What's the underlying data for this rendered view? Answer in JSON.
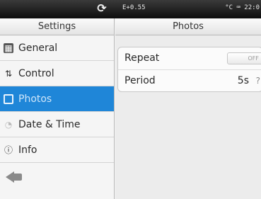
{
  "statusbar": {
    "refresh_icon": "refresh-icon",
    "left_text": "E+0.55",
    "right_text": "°C ⌨ 22:0"
  },
  "sidebar": {
    "title": "Settings",
    "items": [
      {
        "label": "General",
        "icon": "general-icon",
        "selected": false
      },
      {
        "label": "Control",
        "icon": "control-icon",
        "selected": false
      },
      {
        "label": "Photos",
        "icon": "photos-icon",
        "selected": true
      },
      {
        "label": "Date & Time",
        "icon": "clock-icon",
        "selected": false
      },
      {
        "label": "Info",
        "icon": "info-icon",
        "selected": false
      }
    ],
    "back_icon": "back-arrow-icon"
  },
  "main": {
    "title": "Photos",
    "repeat": {
      "label": "Repeat",
      "toggle_label": "OFF"
    },
    "period": {
      "label": "Period",
      "value": "5s",
      "marker": "?"
    }
  },
  "colors": {
    "selected_bg": "#1f86d8",
    "statusbar_bg": "#1a1a1a"
  }
}
